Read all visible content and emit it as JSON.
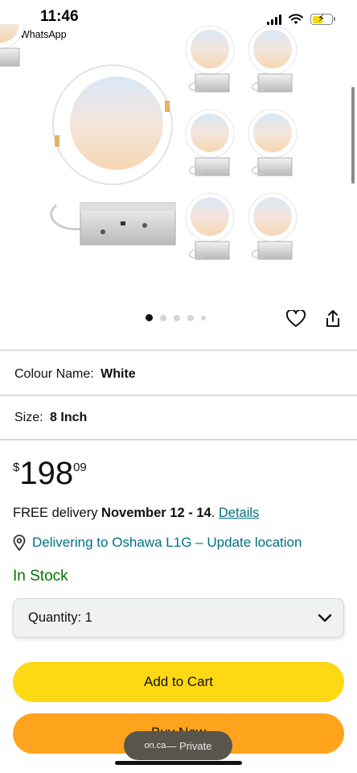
{
  "status_bar": {
    "time": "11:46",
    "back_app": "WhatsApp",
    "icons": [
      "signal-icon",
      "wifi-icon",
      "battery-charging-icon"
    ]
  },
  "product": {
    "image_alt": "Recessed LED panel light with junction box, 6-pack",
    "carousel": {
      "count": 5,
      "active_index": 0
    }
  },
  "actions": {
    "wishlist_icon": "heart-icon",
    "share_icon": "share-icon"
  },
  "variations": {
    "colour_label": "Colour Name:",
    "colour_value": "White",
    "size_label": "Size:",
    "size_value": "8 Inch"
  },
  "price": {
    "symbol": "$",
    "whole": "198",
    "fraction": "09"
  },
  "delivery": {
    "prefix": "FREE delivery ",
    "date": "November 12 - 14",
    "suffix": ". ",
    "details_link": "Details"
  },
  "location": {
    "text": "Delivering to Oshawa L1G – Update location"
  },
  "stock": {
    "text": "In Stock"
  },
  "quantity": {
    "label": "Quantity: 1"
  },
  "buttons": {
    "add_to_cart": "Add to Cart",
    "buy_now": "Buy Now"
  },
  "browser": {
    "domain": "on.ca",
    "mode": " — Private"
  },
  "colors": {
    "link": "#007185",
    "in_stock": "#007600",
    "add_to_cart": "#ffd814",
    "buy_now": "#ffa41c"
  }
}
